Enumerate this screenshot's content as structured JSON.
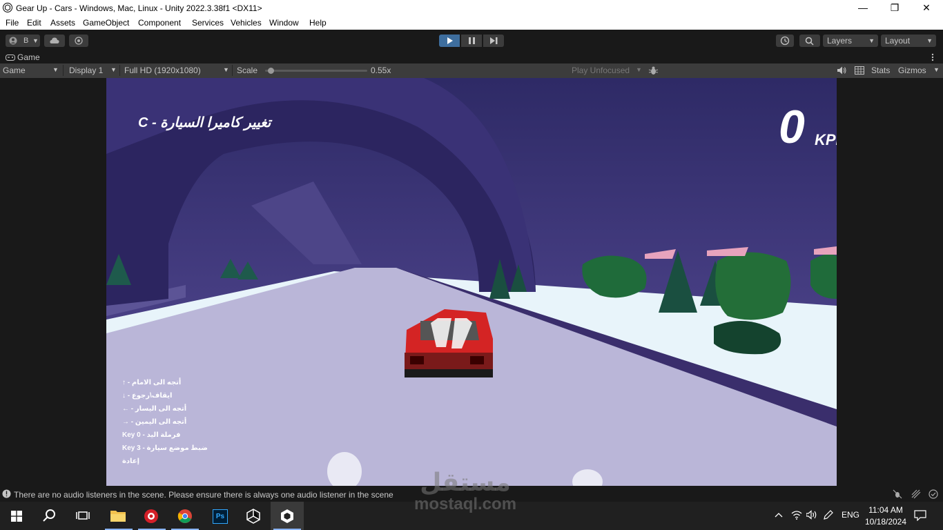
{
  "window": {
    "title": "Gear Up - Cars - Windows, Mac, Linux - Unity 2022.3.38f1 <DX11>",
    "minimize": "—",
    "maximize": "❐",
    "close": "✕"
  },
  "menu": [
    "File",
    "Edit",
    "Assets",
    "GameObject",
    "Component",
    "Services",
    "Vehicles",
    "Window",
    "Help"
  ],
  "toolbar": {
    "account_label": "B",
    "layers_label": "Layers",
    "layout_label": "Layout"
  },
  "game_tab": {
    "label": "Game"
  },
  "game_bar": {
    "mode": "Game",
    "display": "Display 1",
    "resolution": "Full HD (1920x1080)",
    "scale_label": "Scale",
    "scale_value": "0.55x",
    "scale_fraction": 0.03,
    "play_focus": "Play Unfocused",
    "stats": "Stats",
    "gizmos": "Gizmos"
  },
  "hud": {
    "camera_hint": "تغيير كاميرا السيارة - C",
    "speed_value": "0",
    "speed_unit": "KPH",
    "controls": [
      "↑ - أتجه الى الامام",
      "↓ - ايقاف\\رجوع",
      "← - أتجه الى اليسار",
      "→ - أتجه الى اليمين",
      "Key 0 - فرملة اليد",
      "Key 3 - ضبط موضع سيارة",
      "إعادة"
    ]
  },
  "status": {
    "message": "There are no audio listeners in the scene. Please ensure there is always one audio listener in the scene"
  },
  "watermark": {
    "arabic": "مستقل",
    "latin": "mostaql.com"
  },
  "taskbar": {
    "language": "ENG",
    "time": "11:04 AM",
    "date": "10/18/2024",
    "photoshop_label": "Ps"
  },
  "colors": {
    "sky": "#3f3478",
    "road": "#bab6d8",
    "car_red": "#d42424",
    "play_active": "#3e6e9e"
  }
}
